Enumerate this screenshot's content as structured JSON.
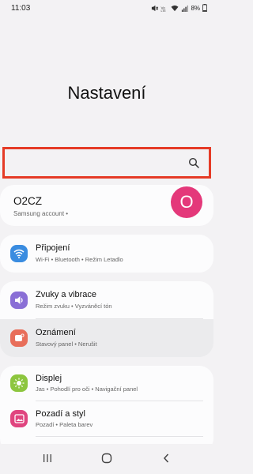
{
  "status": {
    "time": "11:03",
    "battery": "8%",
    "icons": [
      "mute-icon",
      "volte-icon",
      "wifi-signal-icon",
      "cell-signal-icon",
      "battery-icon"
    ]
  },
  "title": "Nastavení",
  "search": {
    "icon": "search-icon"
  },
  "account": {
    "name": "O2CZ",
    "sub": "Samsung account •",
    "avatar_letter": "O",
    "avatar_color": "#e4387a"
  },
  "groups": [
    {
      "items": [
        {
          "title": "Připojení",
          "sub": "Wi-Fi • Bluetooth • Režim Letadlo",
          "icon": "wifi-icon",
          "color": "#3a8ce0"
        }
      ]
    },
    {
      "items": [
        {
          "title": "Zvuky a vibrace",
          "sub": "Režim zvuku • Vyzváněcí tón",
          "icon": "volume-icon",
          "color": "#8a6fd6"
        },
        {
          "title": "Oznámení",
          "sub": "Stavový panel • Nerušit",
          "icon": "notification-icon",
          "color": "#e86e5a"
        }
      ]
    },
    {
      "items": [
        {
          "title": "Displej",
          "sub": "Jas • Pohodlí pro oči • Navigační panel",
          "icon": "brightness-icon",
          "color": "#8dc63f"
        },
        {
          "title": "Pozadí a styl",
          "sub": "Pozadí • Paleta barev",
          "icon": "wallpaper-icon",
          "color": "#e0457f"
        }
      ]
    }
  ],
  "nav": {
    "icons": [
      "recent-apps-icon",
      "home-icon",
      "back-icon"
    ]
  }
}
